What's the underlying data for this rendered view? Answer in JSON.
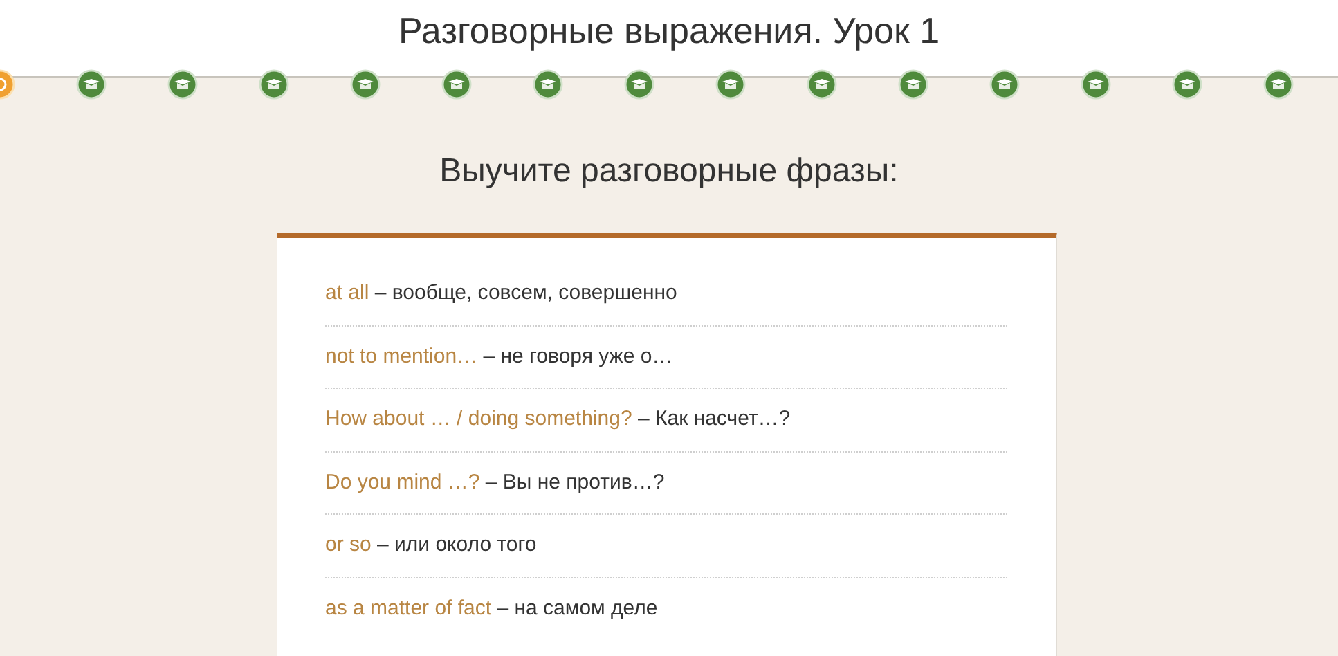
{
  "page_title": "Разговорные выражения. Урок 1",
  "steps": [
    {
      "selected": true
    },
    {
      "selected": false
    },
    {
      "selected": false
    },
    {
      "selected": false
    },
    {
      "selected": false
    },
    {
      "selected": false
    },
    {
      "selected": false
    },
    {
      "selected": false
    },
    {
      "selected": false
    },
    {
      "selected": false
    },
    {
      "selected": false
    },
    {
      "selected": false
    },
    {
      "selected": false
    },
    {
      "selected": false
    },
    {
      "selected": false
    }
  ],
  "heading": "Выучите разговорные фразы:",
  "phrases": [
    {
      "english": "at all",
      "translation": "– вообще, совсем, совершенно"
    },
    {
      "english": "not to mention…",
      "translation": "– не говоря уже о…"
    },
    {
      "english": "How about … / doing something?",
      "translation": "– Как насчет…?"
    },
    {
      "english": "Do you mind …?",
      "translation": "– Вы не против…?"
    },
    {
      "english": "or so",
      "translation": "– или около того"
    },
    {
      "english": "as a matter of fact",
      "translation": "– на самом деле"
    }
  ]
}
